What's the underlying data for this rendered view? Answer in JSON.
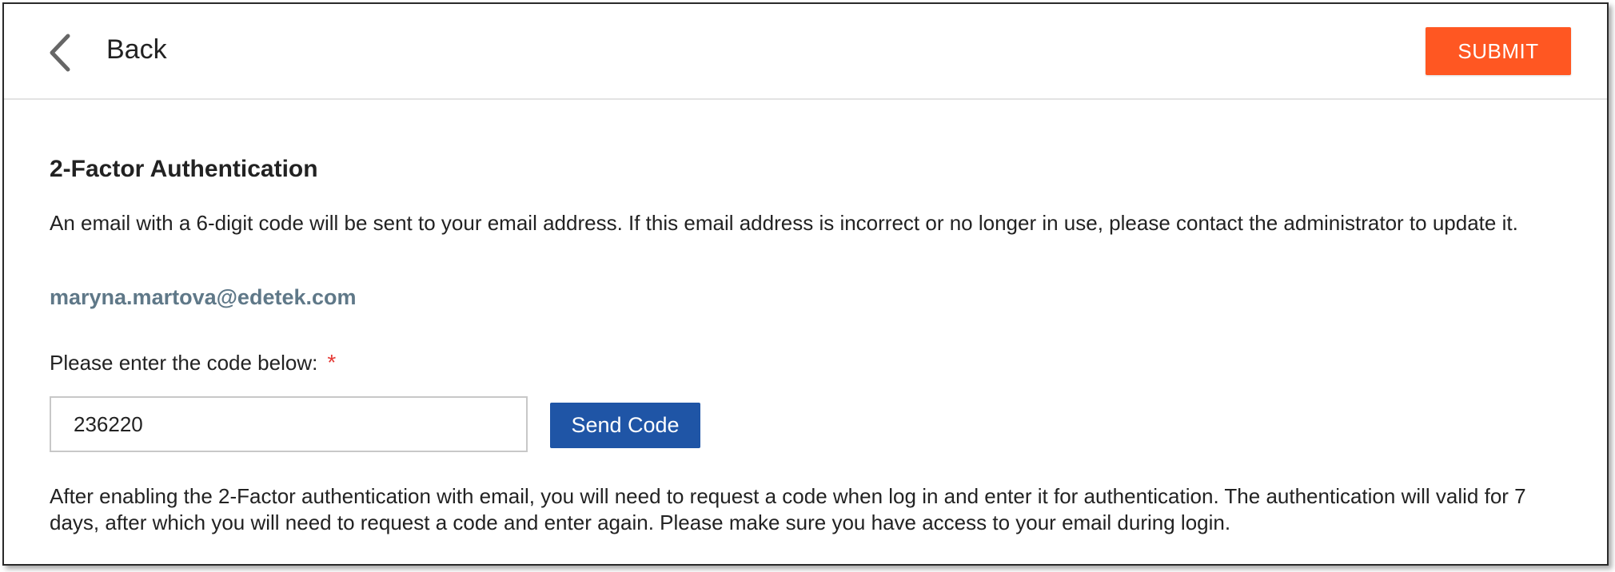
{
  "header": {
    "back_label": "Back",
    "submit_label": "SUBMIT"
  },
  "main": {
    "title": "2-Factor Authentication",
    "description": "An email with a 6-digit code will be sent to your email address. If this email address is incorrect or no longer in use, please contact the administrator to update it.",
    "email": "maryna.martova@edetek.com",
    "code_label": "Please enter the code below:",
    "required_mark": "*",
    "code_value": "236220",
    "send_code_label": "Send Code",
    "footer_note": "After enabling the 2-Factor authentication with email, you will need to request a code when log in and enter it for authentication. The authentication will valid for 7 days, after which you will need to request a code and enter again. Please make sure you have access to your email during login."
  },
  "icons": {
    "back": "chevron-left-icon"
  },
  "colors": {
    "submit_bg": "#ff5722",
    "send_code_bg": "#1f55a6",
    "email_text": "#5f7888",
    "required": "#e53935"
  }
}
